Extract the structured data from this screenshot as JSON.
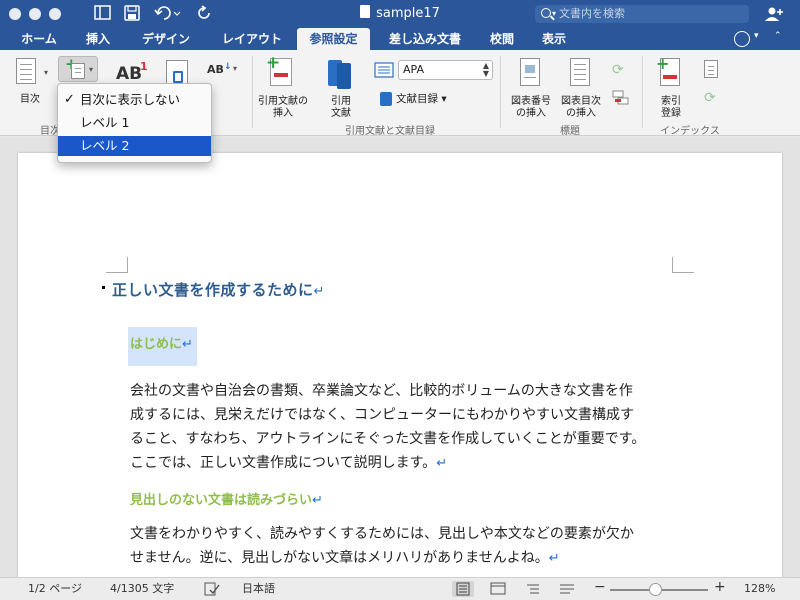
{
  "window": {
    "title": "sample17",
    "search_placeholder": "文書内を検索"
  },
  "tabs": [
    {
      "label": "ホーム"
    },
    {
      "label": "挿入"
    },
    {
      "label": "デザイン"
    },
    {
      "label": "レイアウト"
    },
    {
      "label": "参照設定",
      "active": true
    },
    {
      "label": "差し込み文書"
    },
    {
      "label": "校閲"
    },
    {
      "label": "表示"
    }
  ],
  "ribbon": {
    "toc_label": "目次",
    "toc_group_label": "目次",
    "insert_citation_label": "引用文献の挿入",
    "citation_label_line1": "引用",
    "citation_label_line2": "文献",
    "style_value": "APA",
    "bibliography_label": "文献目録",
    "citation_group_label": "引用文献と文献目録",
    "insert_caption_label_line1": "図表番号",
    "insert_caption_label_line2": "の挿入",
    "insert_tof_label_line1": "図表目次",
    "insert_tof_label_line2": "の挿入",
    "captions_group_label": "標題",
    "mark_entry_label_line1": "索引",
    "mark_entry_label_line2": "登録",
    "index_group_label": "インデックス",
    "footnote_text": "AB",
    "footnote_super": "1"
  },
  "dropdown": {
    "items": [
      {
        "label": "目次に表示しない",
        "checked": true
      },
      {
        "label": "レベル 1"
      },
      {
        "label": "レベル 2",
        "selected": true
      }
    ]
  },
  "document": {
    "heading1": "正しい文書を作成するために",
    "heading2_a": "はじめに",
    "para1": [
      "会社の文書や自治会の書類、卒業論文など、比較的ボリュームの大きな文書を作",
      "成するには、見栄えだけではなく、コンピューターにもわかりやすい文書構成す",
      "ること、すなわち、アウトラインにそぐった文書を作成していくことが重要です。",
      "ここでは、正しい文書作成について説明します。"
    ],
    "heading2_b": "見出しのない文書は読みづらい",
    "para2": [
      "文書をわかりやすく、読みやすくするためには、見出しや本文などの要素が欠か",
      "せません。逆に、見出しがない文章はメリハリがありませんよね。"
    ],
    "para_mark": "↵"
  },
  "statusbar": {
    "page": "1/2 ページ",
    "words": "4/1305 文字",
    "language": "日本語",
    "zoom": "128%",
    "zoom_level": 0.46
  },
  "colors": {
    "titlebar": "#2b579a",
    "heading1": "#2e5c8e",
    "heading2": "#8fbe4a",
    "selection": "#1a57c8"
  }
}
